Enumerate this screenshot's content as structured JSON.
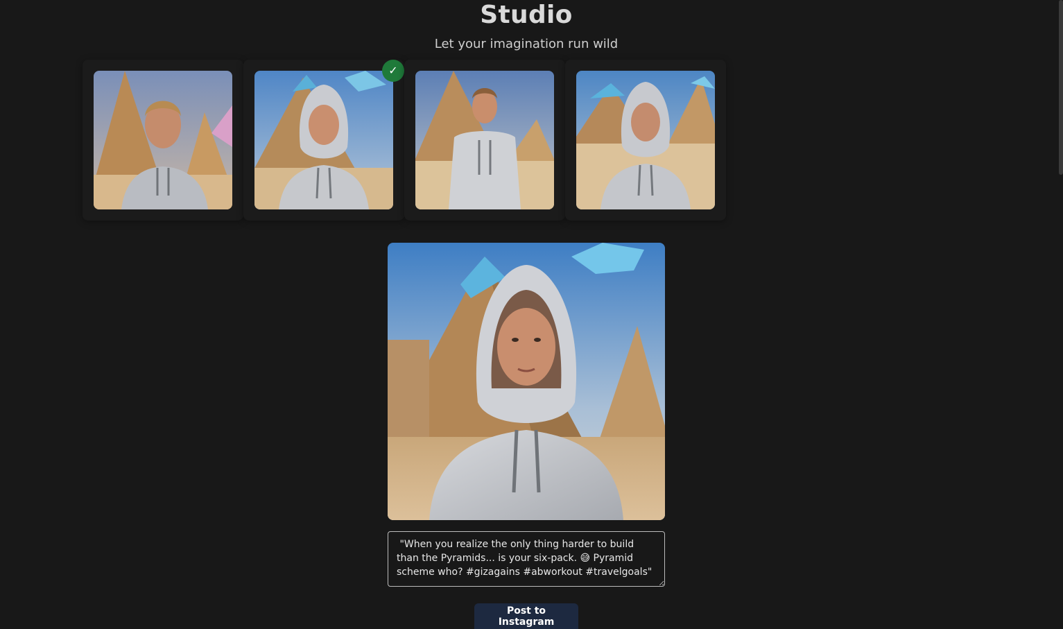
{
  "header": {
    "title": "Studio",
    "subtitle": "Let your imagination run wild"
  },
  "gallery": {
    "selected_index": 1,
    "thumbnails": [
      {
        "alt": "man in grey hoodie before pyramid",
        "selected": false
      },
      {
        "alt": "man in hood before pyramid",
        "selected": true
      },
      {
        "alt": "man in grey t-shirt before pyramid",
        "selected": false
      },
      {
        "alt": "man in hood before pyramids",
        "selected": false
      }
    ],
    "check_glyph": "✓"
  },
  "preview": {
    "alt": "selected image: man in grey hoodie before pyramid"
  },
  "caption": {
    "text": " \"When you realize the only thing harder to build than the Pyramids... is your six-pack. 😅 Pyramid scheme who? #gizagains #abworkout #travelgoals\""
  },
  "actions": {
    "post_label": "Post to Instagram"
  },
  "colors": {
    "background": "#181818",
    "check_badge": "#1f7a3a",
    "button": "#1d2940"
  }
}
